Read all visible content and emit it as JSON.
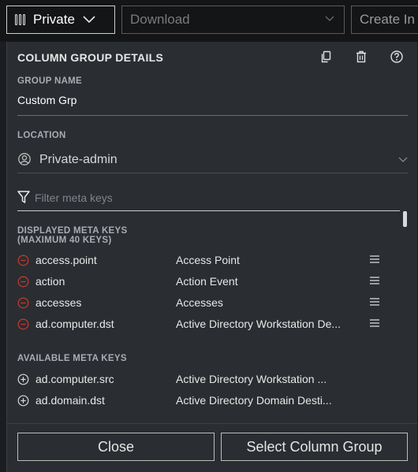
{
  "topbar": {
    "private_label": "Private",
    "download_placeholder": "Download",
    "create_label": "Create In"
  },
  "panel": {
    "title": "COLUMN GROUP DETAILS",
    "group_name_label": "GROUP NAME",
    "group_name_value": "Custom Grp",
    "location_label": "LOCATION",
    "location_value": "Private-admin",
    "filter_placeholder": "Filter meta keys",
    "displayed_label_line1": "DISPLAYED META KEYS",
    "displayed_label_line2": "(MAXIMUM 40 KEYS)",
    "displayed_keys": [
      {
        "key": "access.point",
        "desc": "Access Point"
      },
      {
        "key": "action",
        "desc": "Action Event"
      },
      {
        "key": "accesses",
        "desc": "Accesses"
      },
      {
        "key": "ad.computer.dst",
        "desc": "Active Directory Workstation De..."
      }
    ],
    "available_label": "AVAILABLE META KEYS",
    "available_keys": [
      {
        "key": "ad.computer.src",
        "desc": "Active Directory Workstation ..."
      },
      {
        "key": "ad.domain.dst",
        "desc": "Active Directory Domain Desti..."
      }
    ]
  },
  "footer": {
    "close_label": "Close",
    "select_label": "Select Column Group"
  },
  "colors": {
    "background": "#1b1d20",
    "panel": "#2a2d31",
    "remove_icon": "#c0392b",
    "text": "#e8e8e8"
  }
}
